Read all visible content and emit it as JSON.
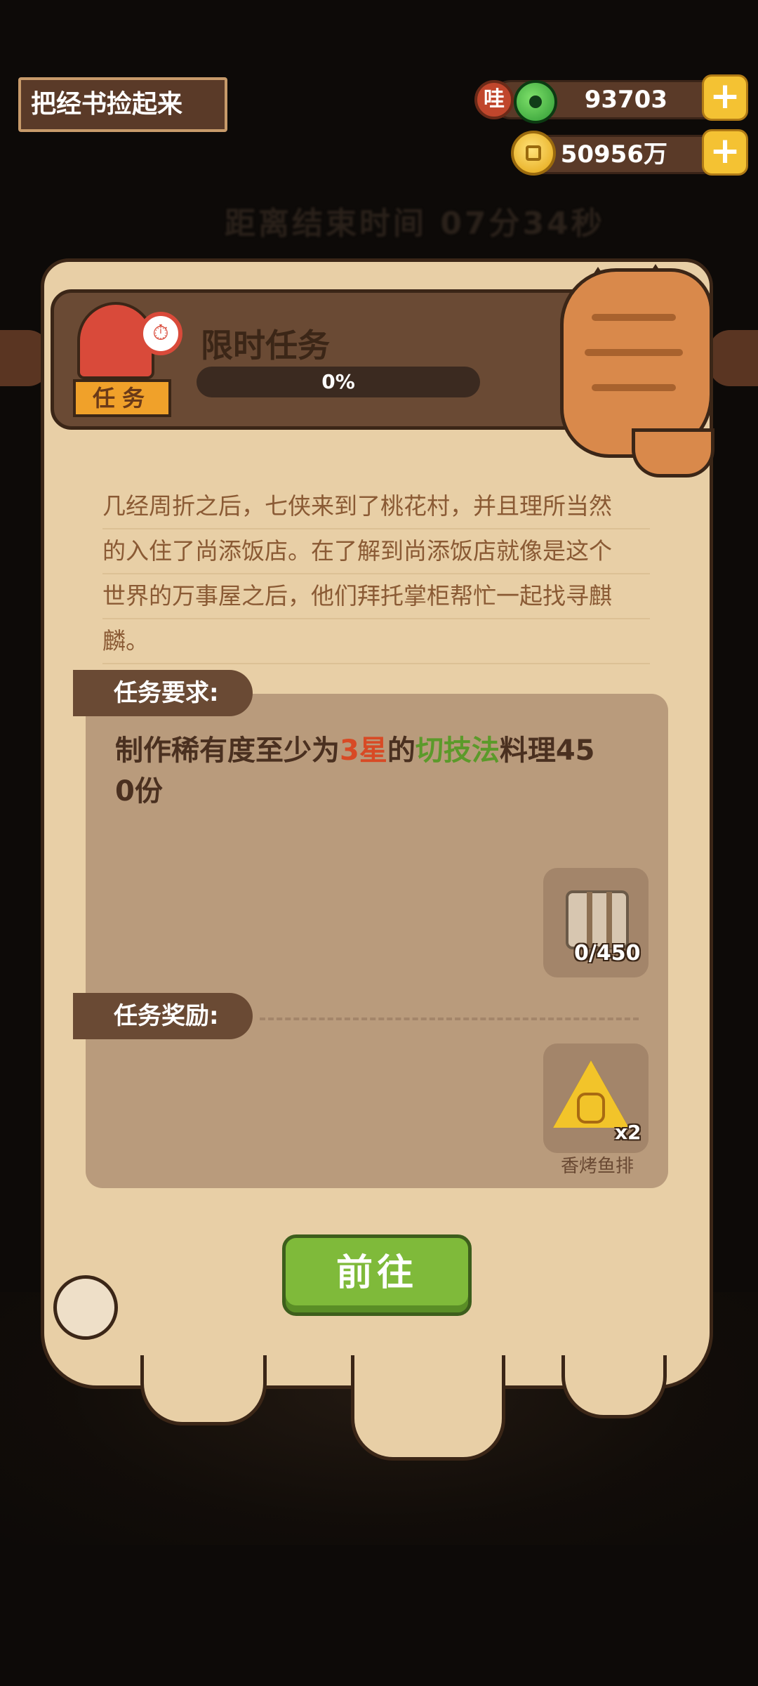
{
  "top_left": {
    "title": "把经书捡起来"
  },
  "currency": {
    "jade": {
      "badge": "哇",
      "value": "93703",
      "plus": "+"
    },
    "coin": {
      "value": "50956万",
      "plus": "+"
    }
  },
  "background": {
    "blurred_timer_text": "距离结束时间 07分34秒"
  },
  "task": {
    "badge_label": "任务",
    "title": "限时任务",
    "progress_percent": "0%",
    "progress_fraction": 0.0,
    "story_lines": [
      "几经周折之后，七侠来到了桃花村，并且理所当然",
      "的入住了尚添饭店。在了解到尚添饭店就像是这个",
      "世界的万事屋之后，他们拜托掌柜帮忙一起找寻麒",
      "麟。"
    ],
    "requirement_label": "任务要求:",
    "requirement": {
      "part1": "制作稀有度至少为",
      "star": "3星",
      "part2": "的",
      "skill": "切技法",
      "part3": "料理45",
      "line2": "0份"
    },
    "requirement_item": {
      "count": "0/450",
      "icon": "scroll-icon"
    },
    "reward_label": "任务奖励:",
    "reward_item": {
      "count": "x2",
      "name": "香烤鱼排",
      "icon": "grilled-fish-icon"
    },
    "go_button": "前往"
  },
  "colors": {
    "accent_red": "#d84a25",
    "accent_green": "#5b9a2a",
    "parchment": "#e8cfa6",
    "button_green": "#7fba3a"
  }
}
